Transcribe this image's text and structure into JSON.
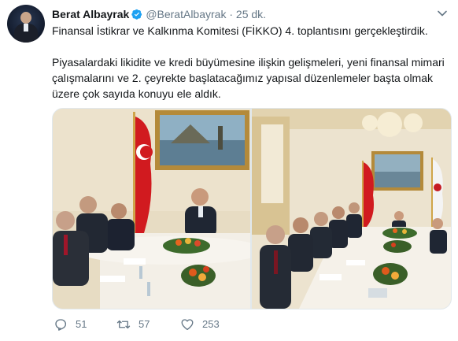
{
  "author": {
    "name": "Berat Albayrak",
    "handle": "@BeratAlbayrak",
    "separator": "·",
    "time": "25 dk."
  },
  "tweet": {
    "line1": "Finansal İstikrar ve Kalkınma Komitesi (FİKKO) 4. toplantısını gerçekleştirdik.",
    "line2": "Piyasalardaki likidite ve kredi büyümesine ilişkin gelişmeleri, yeni finansal mimari çalışmalarını ve 2. çeyrekte başlatacağımız yapısal düzenlemeler başta olmak üzere çok sayıda konuyu ele aldık."
  },
  "actions": {
    "replies": "51",
    "retweets": "57",
    "likes": "253"
  },
  "icons": {
    "verified": "verified-badge-icon",
    "menu": "chevron-down-icon",
    "reply": "reply-icon",
    "retweet": "retweet-icon",
    "like": "heart-icon"
  },
  "colors": {
    "accent": "#1da1f2",
    "muted": "#657786",
    "text": "#14171a"
  }
}
